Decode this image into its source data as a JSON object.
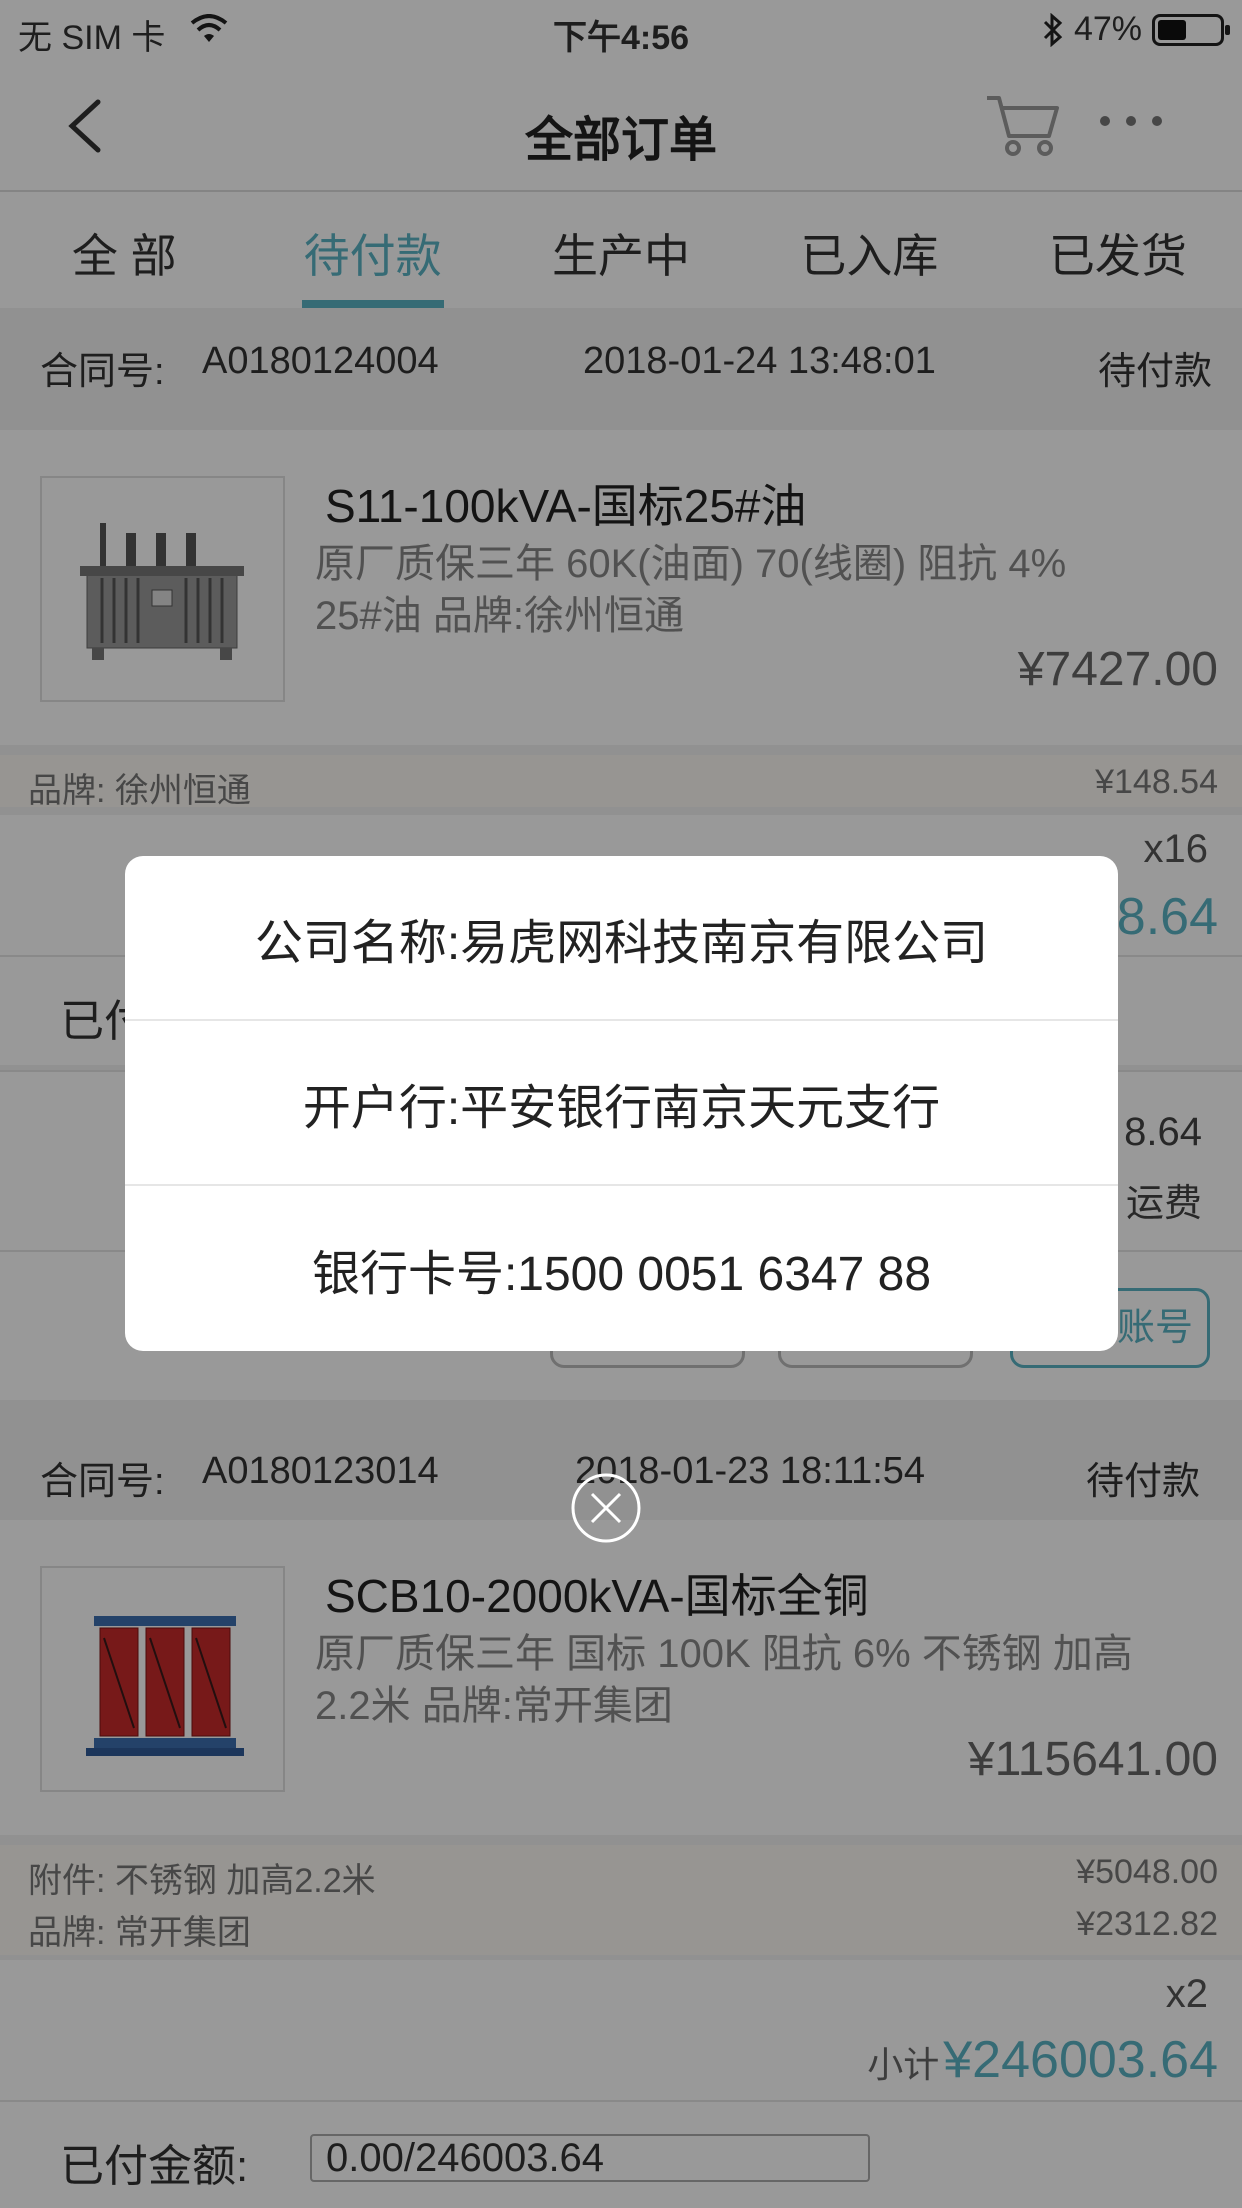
{
  "status_bar": {
    "carrier": "无 SIM 卡",
    "time": "下午4:56",
    "battery": "47%",
    "battery_level": 0.47
  },
  "nav": {
    "title": "全部订单"
  },
  "tabs": [
    {
      "label": "全  部",
      "active": false
    },
    {
      "label": "待付款",
      "active": true
    },
    {
      "label": "生产中",
      "active": false
    },
    {
      "label": "已入库",
      "active": false
    },
    {
      "label": "已发货",
      "active": false
    }
  ],
  "orders": [
    {
      "contract_label": "合同号:",
      "contract_no": "A0180124004",
      "datetime": "2018-01-24 13:48:01",
      "status": "待付款",
      "product_name": "S11-100kVA-国标25#油",
      "spec_line1": "原厂质保三年 60K(油面) 70(线圈) 阻抗 4%",
      "spec_line2": "25#油 品牌:徐州恒通",
      "price": "¥7427.00",
      "brand_label": "品牌:",
      "brand": "徐州恒通",
      "brand_price": "¥148.54",
      "qty": "x16",
      "subtotal_partial": "8.64",
      "paid_label_partial": "已付",
      "amount_partial": "8.64",
      "freight_partial": "运费",
      "account_button_partial": "账号"
    },
    {
      "contract_label": "合同号:",
      "contract_no": "A0180123014",
      "datetime": "2018-01-23 18:11:54",
      "status": "待付款",
      "product_name": "SCB10-2000kVA-国标全铜",
      "spec_line1": "原厂质保三年 国标 100K 阻抗 6% 不锈钢 加高",
      "spec_line2": "2.2米 品牌:常开集团",
      "price": "¥115641.00",
      "accessory_label": "附件:",
      "accessory": "不锈钢 加高2.2米",
      "accessory_price": "¥5048.00",
      "brand_label": "品牌:",
      "brand": "常开集团",
      "brand_price": "¥2312.82",
      "qty": "x2",
      "subtotal_label": "小计",
      "subtotal": "¥246003.64",
      "paid_label": "已付金额:",
      "paid_value": "0.00/246003.64"
    }
  ],
  "dialog": {
    "company": "公司名称:易虎网科技南京有限公司",
    "bank": "开户行:平安银行南京天元支行",
    "card": "银行卡号:1500 0051 6347 88"
  },
  "colors": {
    "accent": "#5ab3c4"
  }
}
